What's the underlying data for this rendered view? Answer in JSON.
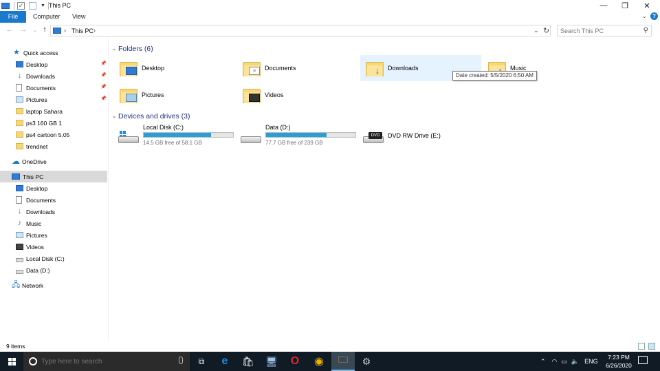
{
  "window": {
    "title": "This PC",
    "controls": {
      "minimize": "—",
      "restore": "❐",
      "close": "✕"
    }
  },
  "ribbon": {
    "tabs": [
      "File",
      "Computer",
      "View"
    ],
    "help": "?"
  },
  "address": {
    "crumb": "This PC",
    "search_placeholder": "Search This PC"
  },
  "nav": {
    "quick_access": "Quick access",
    "quick_items": [
      {
        "label": "Desktop",
        "icon": "desktop-icon",
        "pinned": true
      },
      {
        "label": "Downloads",
        "icon": "downloads-icon",
        "pinned": true
      },
      {
        "label": "Documents",
        "icon": "documents-icon",
        "pinned": true
      },
      {
        "label": "Pictures",
        "icon": "pictures-icon",
        "pinned": true
      },
      {
        "label": "laptop Sahara",
        "icon": "folder-icon",
        "pinned": false
      },
      {
        "label": "ps3 160 GB 1",
        "icon": "folder-icon",
        "pinned": false
      },
      {
        "label": "ps4 cartoon 5.05",
        "icon": "folder-icon",
        "pinned": false
      },
      {
        "label": "trendnet",
        "icon": "folder-icon",
        "pinned": false
      }
    ],
    "onedrive": "OneDrive",
    "this_pc": "This PC",
    "pc_items": [
      {
        "label": "Desktop",
        "icon": "desktop-icon"
      },
      {
        "label": "Documents",
        "icon": "documents-icon"
      },
      {
        "label": "Downloads",
        "icon": "downloads-icon"
      },
      {
        "label": "Music",
        "icon": "music-icon"
      },
      {
        "label": "Pictures",
        "icon": "pictures-icon"
      },
      {
        "label": "Videos",
        "icon": "videos-icon"
      },
      {
        "label": "Local Disk (C:)",
        "icon": "local-disk-icon"
      },
      {
        "label": "Data (D:)",
        "icon": "drive-icon"
      }
    ],
    "network": "Network"
  },
  "content": {
    "folders_header": "Folders (6)",
    "folders": [
      {
        "name": "Desktop",
        "icon": "desktop-folder-icon"
      },
      {
        "name": "Documents",
        "icon": "documents-folder-icon"
      },
      {
        "name": "Downloads",
        "icon": "downloads-folder-icon"
      },
      {
        "name": "Music",
        "icon": "music-folder-icon"
      },
      {
        "name": "Pictures",
        "icon": "pictures-folder-icon"
      },
      {
        "name": "Videos",
        "icon": "videos-folder-icon"
      }
    ],
    "tooltip": "Date created: 5/5/2020 6:50 AM",
    "devices_header": "Devices and drives (3)",
    "drives": [
      {
        "name": "Local Disk (C:)",
        "free": "14.5 GB free of 58.1 GB",
        "used_fraction": 0.75
      },
      {
        "name": "Data (D:)",
        "free": "77.7 GB free of 239 GB",
        "used_fraction": 0.675
      },
      {
        "name": "DVD RW Drive (E:)"
      }
    ],
    "dvd_label": "DVD"
  },
  "status": {
    "items_count": "9 items"
  },
  "taskbar": {
    "search_placeholder": "Type here to search",
    "language": "ENG",
    "time": "7:23 PM",
    "date": "6/26/2020",
    "accent": "#1979ca"
  }
}
